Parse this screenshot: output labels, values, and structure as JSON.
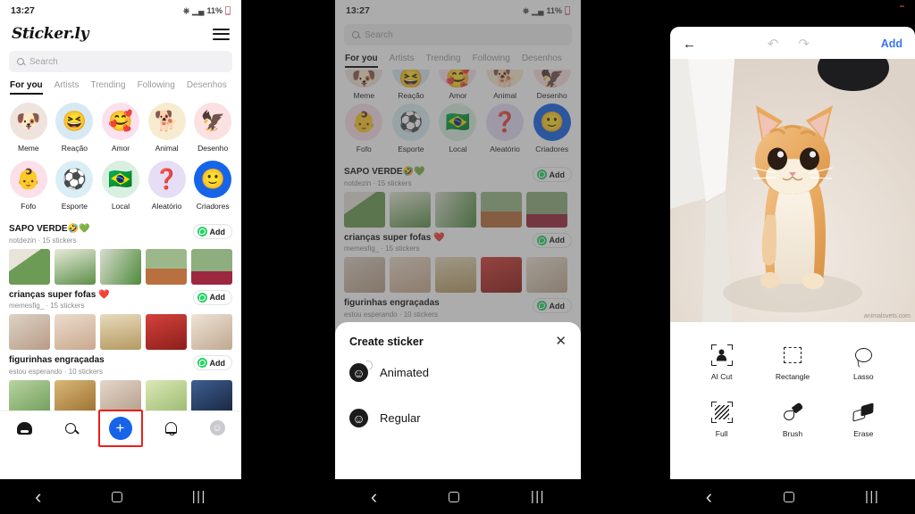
{
  "status_bar": {
    "time": "13:27",
    "battery": "11%",
    "wifi_icon": "wifi-icon",
    "signal_icon": "signal-icon"
  },
  "app": {
    "brand": "Sticker.ly",
    "menu_icon": "hamburger-menu-icon",
    "search": {
      "placeholder": "Search",
      "icon": "search-icon"
    },
    "tabs": [
      {
        "label": "For you",
        "active": true
      },
      {
        "label": "Artists",
        "active": false
      },
      {
        "label": "Trending",
        "active": false
      },
      {
        "label": "Following",
        "active": false
      },
      {
        "label": "Desenhos",
        "active": false
      }
    ],
    "categories_row1": [
      {
        "label": "Meme",
        "glyph": "🐶",
        "bg": "#efe3de"
      },
      {
        "label": "Reação",
        "glyph": "😆",
        "bg": "#d9e9f3"
      },
      {
        "label": "Amor",
        "glyph": "🥰",
        "bg": "#fbe0ee"
      },
      {
        "label": "Animal",
        "glyph": "🐕",
        "bg": "#f7ecd0"
      },
      {
        "label": "Desenho",
        "glyph": "🦅",
        "bg": "#fbe1e1"
      }
    ],
    "categories_row2": [
      {
        "label": "Fofo",
        "glyph": "👶",
        "bg": "#fbe0ea"
      },
      {
        "label": "Esporte",
        "glyph": "⚽",
        "bg": "#d9eef5"
      },
      {
        "label": "Local",
        "glyph": "🇧🇷",
        "bg": "#d9f0e0"
      },
      {
        "label": "Aleatório",
        "glyph": "❓",
        "bg": "#e6ddf6"
      },
      {
        "label": "Criadores",
        "glyph": "🙂",
        "bg": "#1664e8"
      }
    ],
    "packs": [
      {
        "title": "SAPO VERDE🤣💚",
        "subtitle": "notdezin · 15 stickers",
        "add_label": "Add",
        "add_icon": "whatsapp-icon",
        "thumbs": [
          "#cfd4c8",
          "#dfe4d6",
          "#c3cdb8",
          "#b9c6ae",
          "#a8442f"
        ]
      },
      {
        "title": "crianças super fofas ❤️",
        "subtitle": "memesfig_ · 15 stickers",
        "add_label": "Add",
        "add_icon": "whatsapp-icon",
        "thumbs": [
          "#d9cfc4",
          "#e6d6c8",
          "#e0d2b8",
          "#c23a35",
          "#e7dbd0"
        ]
      },
      {
        "title": "figurinhas engraçadas",
        "subtitle": "estou esperando · 10 stickers",
        "add_label": "Add",
        "add_icon": "whatsapp-icon",
        "thumbs": [
          "#9bc08e",
          "#caa25a",
          "#d9c9bc",
          "#cfe0a8",
          "#2c4a7a"
        ]
      }
    ],
    "bottom_nav": [
      {
        "name": "home",
        "icon": "home-icon",
        "active": true
      },
      {
        "name": "search",
        "icon": "search-icon",
        "active": false
      },
      {
        "name": "create",
        "icon": "plus-icon",
        "active": false,
        "highlighted": true
      },
      {
        "name": "notifications",
        "icon": "bell-icon",
        "active": false
      },
      {
        "name": "profile",
        "icon": "profile-avatar-icon",
        "active": false
      }
    ]
  },
  "sheet": {
    "title": "Create sticker",
    "close_icon": "close-icon",
    "options": [
      {
        "label": "Animated",
        "icon": "animated-smiley-icon"
      },
      {
        "label": "Regular",
        "icon": "smiley-icon"
      }
    ]
  },
  "editor": {
    "back_icon": "back-arrow-icon",
    "undo_icon": "undo-icon",
    "redo_icon": "redo-icon",
    "add_label": "Add",
    "photo_alt": "orange-tabby-kitten-standing",
    "watermark": "animalsvets.com",
    "tools_row1": [
      {
        "label": "AI Cut",
        "icon": "ai-cut-icon"
      },
      {
        "label": "Rectangle",
        "icon": "rectangle-select-icon"
      },
      {
        "label": "Lasso",
        "icon": "lasso-icon"
      }
    ],
    "tools_row2": [
      {
        "label": "Full",
        "icon": "full-select-icon"
      },
      {
        "label": "Brush",
        "icon": "brush-icon"
      },
      {
        "label": "Erase",
        "icon": "eraser-icon"
      }
    ]
  },
  "android_nav": {
    "back": "back-nav-icon",
    "home": "home-nav-icon",
    "recents": "recents-nav-icon"
  },
  "colors": {
    "accent_blue": "#1664e8",
    "link_blue": "#3a74f2",
    "whatsapp_green": "#25D366",
    "highlight_red": "#e8201b"
  }
}
